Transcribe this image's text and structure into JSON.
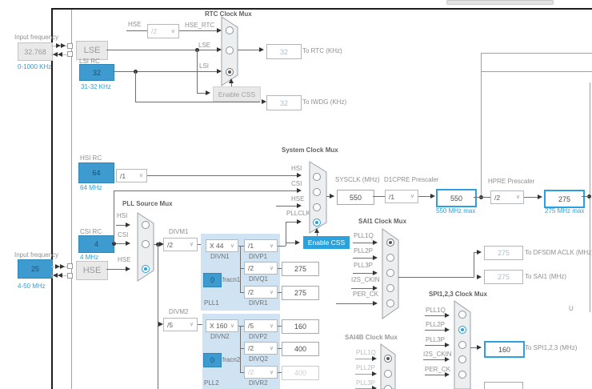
{
  "colors": {
    "accent_fill": "#3d9bd0",
    "accent_border": "#2da0e2",
    "blue_text": "#2f9fdb",
    "pll_bg": "#cfe3f2",
    "mux_fill": "#eceef0"
  },
  "lse_panel": {
    "label": "Input frequency",
    "value": "32.768",
    "range": "0-1000 KHz"
  },
  "lse": {
    "osc_label": "LSE"
  },
  "lsi": {
    "label": "LSI RC",
    "value": "32",
    "range": "31-32 KHz"
  },
  "rtc": {
    "title": "RTC Clock Mux",
    "hse_label": "HSE",
    "hse_div": "/2",
    "hse_rtc_label": "HSE_RTC",
    "lse_label": "LSE",
    "lsi_label": "LSI",
    "enable_css": "Enable CSS",
    "rtc_out": "32",
    "rtc_out_label": "To RTC (KHz)",
    "iwdg_out": "32",
    "iwdg_out_label": "To IWDG (KHz)"
  },
  "hsi": {
    "label": "HSI RC",
    "value": "64",
    "freq": "64 MHz",
    "div": "/1"
  },
  "csi": {
    "label": "CSI RC",
    "value": "4",
    "freq": "4 MHz"
  },
  "hse_panel": {
    "label": "Input frequency",
    "value": "25",
    "range": "4-50 MHz",
    "osc_label": "HSE"
  },
  "pll_mux": {
    "title": "PLL Source Mux",
    "inputs": [
      "HSI",
      "CSI",
      "HSE"
    ]
  },
  "sys": {
    "title": "System Clock Mux",
    "inputs": [
      "HSI",
      "CSI",
      "HSE",
      "PLLCLK"
    ],
    "enable_css": "Enable CSS",
    "sysclk_label": "SYSCLK (MHz)",
    "sysclk": "550",
    "d1cpre_label": "D1CPRE Prescaler",
    "d1cpre": "/1",
    "d1cpre_out": "550",
    "d1cpre_max": "550 MHz max",
    "hpre_label": "HPRE Prescaler",
    "hpre": "/2",
    "hpre_out": "275",
    "hpre_max": "275 MHz max"
  },
  "pll1": {
    "divm_label": "DIVM1",
    "divm": "/2",
    "divn_label": "DIVN1",
    "divn": "X 44",
    "frac_label": "fracn1",
    "frac": "0",
    "name": "PLL1",
    "divp_label": "DIVP1",
    "divp": "/1",
    "divq_label": "DIVQ1",
    "divq": "/2",
    "divq_out": "275",
    "divr_label": "DIVR1",
    "divr": "/2",
    "divr_out": "275"
  },
  "pll2": {
    "divm_label": "DIVM2",
    "divm": "/5",
    "divn_label": "DIVN2",
    "divn": "X 160",
    "frac_label": "fracn2",
    "frac": "0",
    "name": "PLL2",
    "divp_label": "DIVP2",
    "divp": "/5",
    "divp_out": "160",
    "divq_label": "DIVQ2",
    "divq": "/2",
    "divq_out": "400",
    "divr_label": "DIVR2",
    "divr": "/2",
    "divr_out": "400"
  },
  "sai1": {
    "title": "SAI1 Clock Mux",
    "inputs": [
      "PLL1Q",
      "PLL2P",
      "PLL3P",
      "I2S_CKIN",
      "PER_CK"
    ],
    "dfsdm_out": "275",
    "dfsdm_label": "To DFSDM ACLK (MHz)",
    "sai1_out": "275",
    "sai1_label": "To SAI1 (MHz)"
  },
  "spi": {
    "title": "SPI1,2,3 Clock Mux",
    "inputs": [
      "PLL1Q",
      "PLL2P",
      "PLL3P",
      "I2S_CKIN",
      "PER_CK"
    ],
    "out": "160",
    "out_label": "To SPI1,2,3 (MHz)"
  },
  "sai4b": {
    "title": "SAI4B Clock Mux",
    "inputs": [
      "PLL1Q",
      "PLL2P",
      "PLL3P"
    ]
  },
  "misc": {
    "truncated_label": "U"
  }
}
